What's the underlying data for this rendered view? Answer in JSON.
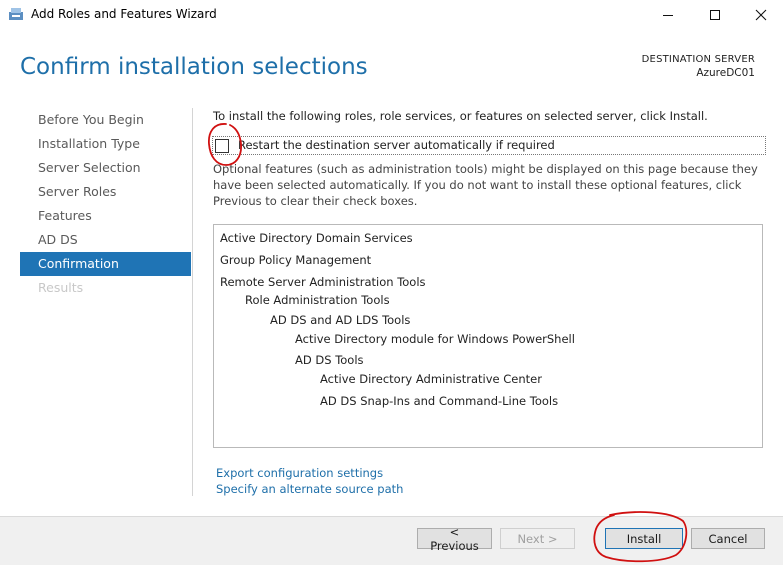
{
  "window": {
    "title": "Add Roles and Features Wizard",
    "controls": [
      "minimize-icon",
      "maximize-icon",
      "close-icon"
    ]
  },
  "header": {
    "page_title": "Confirm installation selections",
    "destination_label": "DESTINATION SERVER",
    "destination_server": "AzureDC01"
  },
  "sidebar": {
    "items": [
      {
        "label": "Before You Begin",
        "state": "normal"
      },
      {
        "label": "Installation Type",
        "state": "normal"
      },
      {
        "label": "Server Selection",
        "state": "normal"
      },
      {
        "label": "Server Roles",
        "state": "normal"
      },
      {
        "label": "Features",
        "state": "normal"
      },
      {
        "label": "AD DS",
        "state": "normal"
      },
      {
        "label": "Confirmation",
        "state": "active"
      },
      {
        "label": "Results",
        "state": "disabled"
      }
    ]
  },
  "main": {
    "intro": "To install the following roles, role services, or features on selected server, click Install.",
    "restart_label": "Restart the destination server automatically if required",
    "restart_checked": false,
    "optional_note": "Optional features (such as administration tools) might be displayed on this page because they have been selected automatically. If you do not want to install these optional features, click Previous to clear their check boxes.",
    "features": [
      {
        "label": "Active Directory Domain Services",
        "level": 0
      },
      {
        "label": "Group Policy Management",
        "level": 0
      },
      {
        "label": "Remote Server Administration Tools",
        "level": 0
      },
      {
        "label": "Role Administration Tools",
        "level": 1
      },
      {
        "label": "AD DS and AD LDS Tools",
        "level": 2
      },
      {
        "label": "Active Directory module for Windows PowerShell",
        "level": 3
      },
      {
        "label": "AD DS Tools",
        "level": 3
      },
      {
        "label": "Active Directory Administrative Center",
        "level": 4
      },
      {
        "label": "AD DS Snap-Ins and Command-Line Tools",
        "level": 4
      }
    ],
    "links": {
      "export": "Export configuration settings",
      "alternate_source": "Specify an alternate source path"
    }
  },
  "footer": {
    "previous": "< Previous",
    "next": "Next >",
    "install": "Install",
    "cancel": "Cancel"
  },
  "colors": {
    "accent": "#1f74b5",
    "title": "#1e6fa9",
    "annotation": "#d01010"
  }
}
